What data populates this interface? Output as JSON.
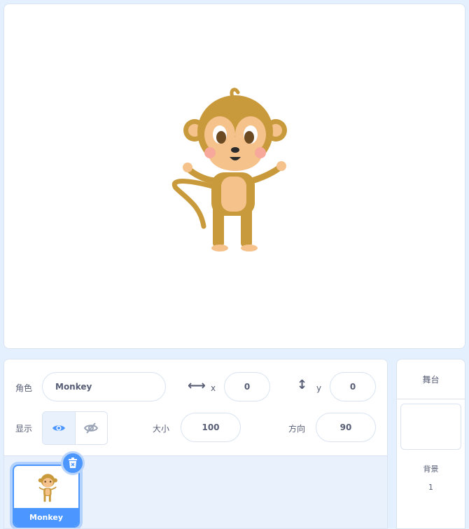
{
  "colors": {
    "accent": "#4c97ff",
    "text": "#575e75",
    "panel_bg": "#e9f1fc",
    "border": "#d9e3f2"
  },
  "stage": {
    "sprite_icon": "monkey-sprite"
  },
  "sprite_info": {
    "sprite_label": "角色",
    "sprite_name": "Monkey",
    "x_icon": "horizontal-arrows-icon",
    "x_label": "x",
    "x_value": "0",
    "y_icon": "vertical-arrows-icon",
    "y_label": "y",
    "y_value": "0",
    "show_label": "显示",
    "show_icon": "eye-icon",
    "hide_icon": "eye-slash-icon",
    "size_label": "大小",
    "size_value": "100",
    "direction_label": "方向",
    "direction_value": "90"
  },
  "sprite_list": {
    "items": [
      {
        "name": "Monkey",
        "selected": true
      }
    ],
    "delete_icon": "trash-icon"
  },
  "stage_pane": {
    "title": "舞台",
    "backdrops_label": "背景",
    "backdrops_count": "1"
  }
}
